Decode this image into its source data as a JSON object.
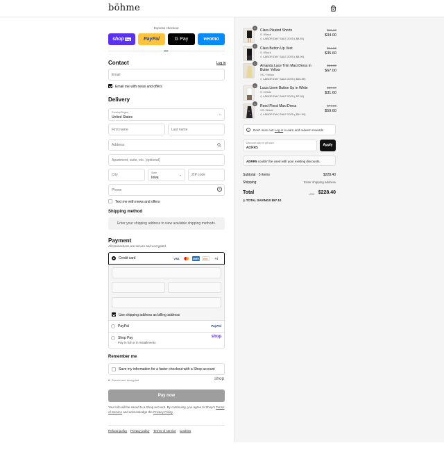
{
  "header": {
    "logo": "böhme",
    "bag_icon": "shopping-bag-icon"
  },
  "express": {
    "label": "Express checkout",
    "shop_pay": "shop",
    "shop_pay_badge": "Pay",
    "paypal": "PayPal",
    "gpay": "G Pay",
    "venmo": "venmo",
    "or": "OR"
  },
  "contact": {
    "title": "Contact",
    "login": "Log in",
    "email_placeholder": "Email",
    "news_label": "Email me with news and offers"
  },
  "delivery": {
    "title": "Delivery",
    "country_label": "Country/Region",
    "country_value": "United States",
    "first_name": "First name",
    "last_name": "Last name",
    "address": "Address",
    "apartment": "Apartment, suite, etc. (optional)",
    "city": "City",
    "state_label": "State",
    "state_value": "Iowa",
    "zip": "ZIP code",
    "phone": "Phone",
    "text_label": "Text me with news and offers"
  },
  "shipping": {
    "title": "Shipping method",
    "info": "Enter your shipping address to view available shipping methods."
  },
  "payment": {
    "title": "Payment",
    "subtitle": "All transactions are secure and encrypted.",
    "credit_card": "Credit card",
    "more_cards": "+4",
    "billing_label": "Use shipping address as billing address",
    "paypal": "PayPal",
    "paypal_logo": "PayPal",
    "shop_pay": "Shop Pay",
    "shop_pay_sub": "Pay in full or in installments",
    "shop_logo": "shop"
  },
  "remember": {
    "title": "Remember me",
    "save_label": "Save my information for a faster checkout with a Shop account",
    "secure": "Secure and encrypted",
    "shop_logo": "shop"
  },
  "pay_button": "Pay now",
  "legal": {
    "text": "Your info will be saved to a Shop account. By continuing, you agree to Shop's",
    "terms": "Terms of Service",
    "and": "and acknowledge the",
    "privacy": "Privacy Policy"
  },
  "footer": {
    "refund": "Refund policy",
    "privacy": "Privacy policy",
    "terms": "Terms of service",
    "cookies": "Cookies"
  },
  "cart": {
    "items": [
      {
        "name": "Clara Pleated Shorts",
        "variant": "S / Black",
        "sale": "LABOR DAY SALE 2025 (-$8.50)",
        "old": "$42.50",
        "price": "$34.00",
        "qty": "1"
      },
      {
        "name": "Clara Button Up Vest",
        "variant": "S / Black",
        "sale": "LABOR DAY SALE 2025 (-$8.90)",
        "old": "$44.50",
        "price": "$35.60",
        "qty": "1"
      },
      {
        "name": "Amanda Lace Trim Maxi Dress in Butter Yellow",
        "variant": "XS / Yellow",
        "sale": "LABOR DAY SALE 2025 (-$16.80)",
        "old": "$84.00",
        "price": "$67.00",
        "qty": "1"
      },
      {
        "name": "Lucia Linen Button Up in White",
        "variant": "S / White",
        "sale": "LABOR DAY SALE 2025 (-$7.90)",
        "old": "$39.50",
        "price": "$31.60",
        "qty": "1"
      },
      {
        "name": "Reed Floral Maxi Dress",
        "variant": "XS / Black",
        "sale": "LABOR DAY SALE 2025 (-$14.90)",
        "old": "$74.50",
        "price": "$59.60",
        "qty": "1"
      }
    ],
    "promo_pre": "Don't miss out!",
    "promo_link": "Log in",
    "promo_post": "to earn and redeem rewards",
    "discount_label": "Discount code or gift card",
    "discount_value": "ADRR5",
    "apply": "Apply",
    "error_code": "ADRR5",
    "error_text": "couldn't be used with your existing discounts.",
    "subtotal_label": "Subtotal · 5 items",
    "subtotal_value": "$228.40",
    "shipping_label": "Shipping",
    "shipping_value": "Enter shipping address",
    "total_label": "Total",
    "currency": "USD",
    "total_value": "$228.40",
    "savings_label": "TOTAL SAVINGS",
    "savings_value": "$57.10"
  },
  "colors": {
    "shop_pay": "#5a31f4",
    "paypal": "#ffc439",
    "venmo": "#008cff",
    "apply": "#111111",
    "pay_disabled": "#9e9e9e"
  }
}
